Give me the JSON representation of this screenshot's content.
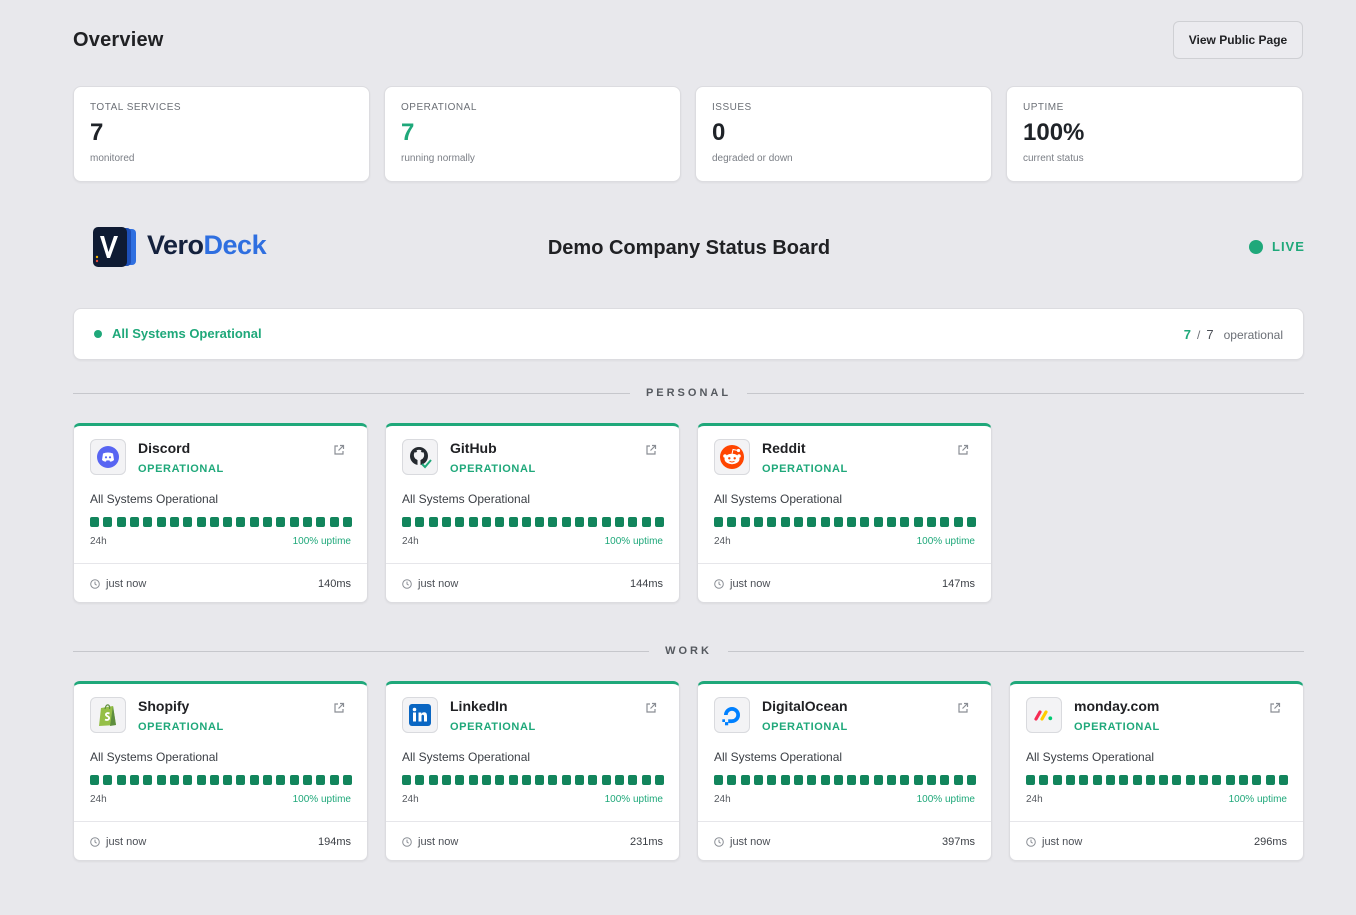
{
  "header": {
    "title": "Overview",
    "view_public_label": "View Public Page"
  },
  "stats": [
    {
      "label": "TOTAL SERVICES",
      "value": "7",
      "sub": "monitored"
    },
    {
      "label": "OPERATIONAL",
      "value": "7",
      "sub": "running normally"
    },
    {
      "label": "ISSUES",
      "value": "0",
      "sub": "degraded or down"
    },
    {
      "label": "UPTIME",
      "value": "100%",
      "sub": "current status"
    }
  ],
  "brand": {
    "part1": "Vero",
    "part2": "Deck",
    "logo_letter": "V"
  },
  "board": {
    "title": "Demo Company Status Board",
    "live_label": "LIVE"
  },
  "summary": {
    "status": "All Systems Operational",
    "operational": "7",
    "sep": "/",
    "total": "7",
    "suffix": "operational"
  },
  "colors": {
    "accent": "#1fa87a",
    "bar": "#12855c",
    "background": "#e8e8ec"
  },
  "sections": {
    "personal": {
      "title": "PERSONAL",
      "services": [
        {
          "name": "Discord",
          "icon": "discord-icon",
          "state": "OPERATIONAL",
          "message": "All Systems Operational",
          "period": "24h",
          "uptime": "100% uptime",
          "updated": "just now",
          "latency": "140ms",
          "bars_up": 20
        },
        {
          "name": "GitHub",
          "icon": "github-icon",
          "state": "OPERATIONAL",
          "message": "All Systems Operational",
          "period": "24h",
          "uptime": "100% uptime",
          "updated": "just now",
          "latency": "144ms",
          "bars_up": 20
        },
        {
          "name": "Reddit",
          "icon": "reddit-icon",
          "state": "OPERATIONAL",
          "message": "All Systems Operational",
          "period": "24h",
          "uptime": "100% uptime",
          "updated": "just now",
          "latency": "147ms",
          "bars_up": 20
        }
      ]
    },
    "work": {
      "title": "WORK",
      "services": [
        {
          "name": "Shopify",
          "icon": "shopify-icon",
          "state": "OPERATIONAL",
          "message": "All Systems Operational",
          "period": "24h",
          "uptime": "100% uptime",
          "updated": "just now",
          "latency": "194ms",
          "bars_up": 20
        },
        {
          "name": "LinkedIn",
          "icon": "linkedin-icon",
          "state": "OPERATIONAL",
          "message": "All Systems Operational",
          "period": "24h",
          "uptime": "100% uptime",
          "updated": "just now",
          "latency": "231ms",
          "bars_up": 20
        },
        {
          "name": "DigitalOcean",
          "icon": "digitalocean-icon",
          "state": "OPERATIONAL",
          "message": "All Systems Operational",
          "period": "24h",
          "uptime": "100% uptime",
          "updated": "just now",
          "latency": "397ms",
          "bars_up": 20
        },
        {
          "name": "monday.com",
          "icon": "monday-icon",
          "state": "OPERATIONAL",
          "message": "All Systems Operational",
          "period": "24h",
          "uptime": "100% uptime",
          "updated": "just now",
          "latency": "296ms",
          "bars_up": 20
        }
      ]
    }
  }
}
